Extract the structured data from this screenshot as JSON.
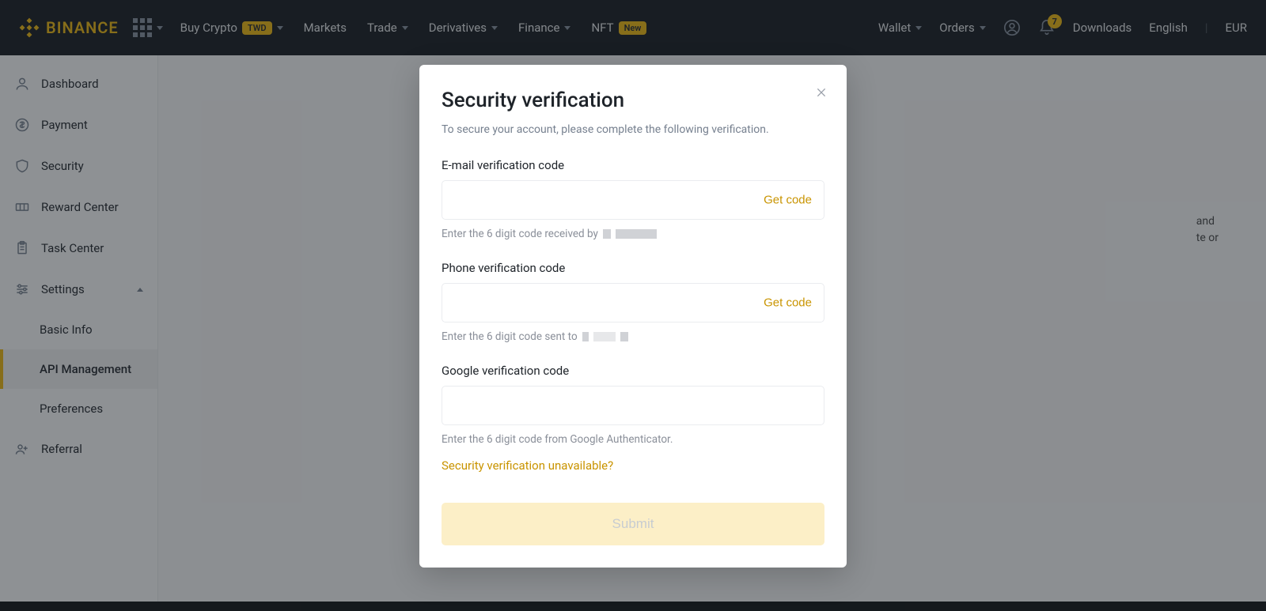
{
  "header": {
    "brand": "BINANCE",
    "nav": {
      "buy_crypto": "Buy Crypto",
      "buy_crypto_pill": "TWD",
      "markets": "Markets",
      "trade": "Trade",
      "derivatives": "Derivatives",
      "finance": "Finance",
      "nft": "NFT",
      "nft_pill": "New"
    },
    "right": {
      "wallet": "Wallet",
      "orders": "Orders",
      "downloads": "Downloads",
      "language": "English",
      "currency": "EUR",
      "notif_count": "7"
    }
  },
  "sidebar": {
    "dashboard": "Dashboard",
    "payment": "Payment",
    "security": "Security",
    "reward": "Reward Center",
    "task": "Task Center",
    "settings": "Settings",
    "basic": "Basic Info",
    "api": "API Management",
    "prefs": "Preferences",
    "referral": "Referral"
  },
  "bg": {
    "line1": "and",
    "line2": "te or"
  },
  "modal": {
    "title": "Security verification",
    "desc": "To secure your account, please complete the following verification.",
    "email_label": "E-mail verification code",
    "email_help": "Enter the 6 digit code received by",
    "phone_label": "Phone verification code",
    "phone_help": "Enter the 6 digit code sent to",
    "google_label": "Google verification code",
    "google_help": "Enter the 6 digit code from Google Authenticator.",
    "get_code": "Get code",
    "unavailable": "Security verification unavailable?",
    "submit": "Submit"
  }
}
